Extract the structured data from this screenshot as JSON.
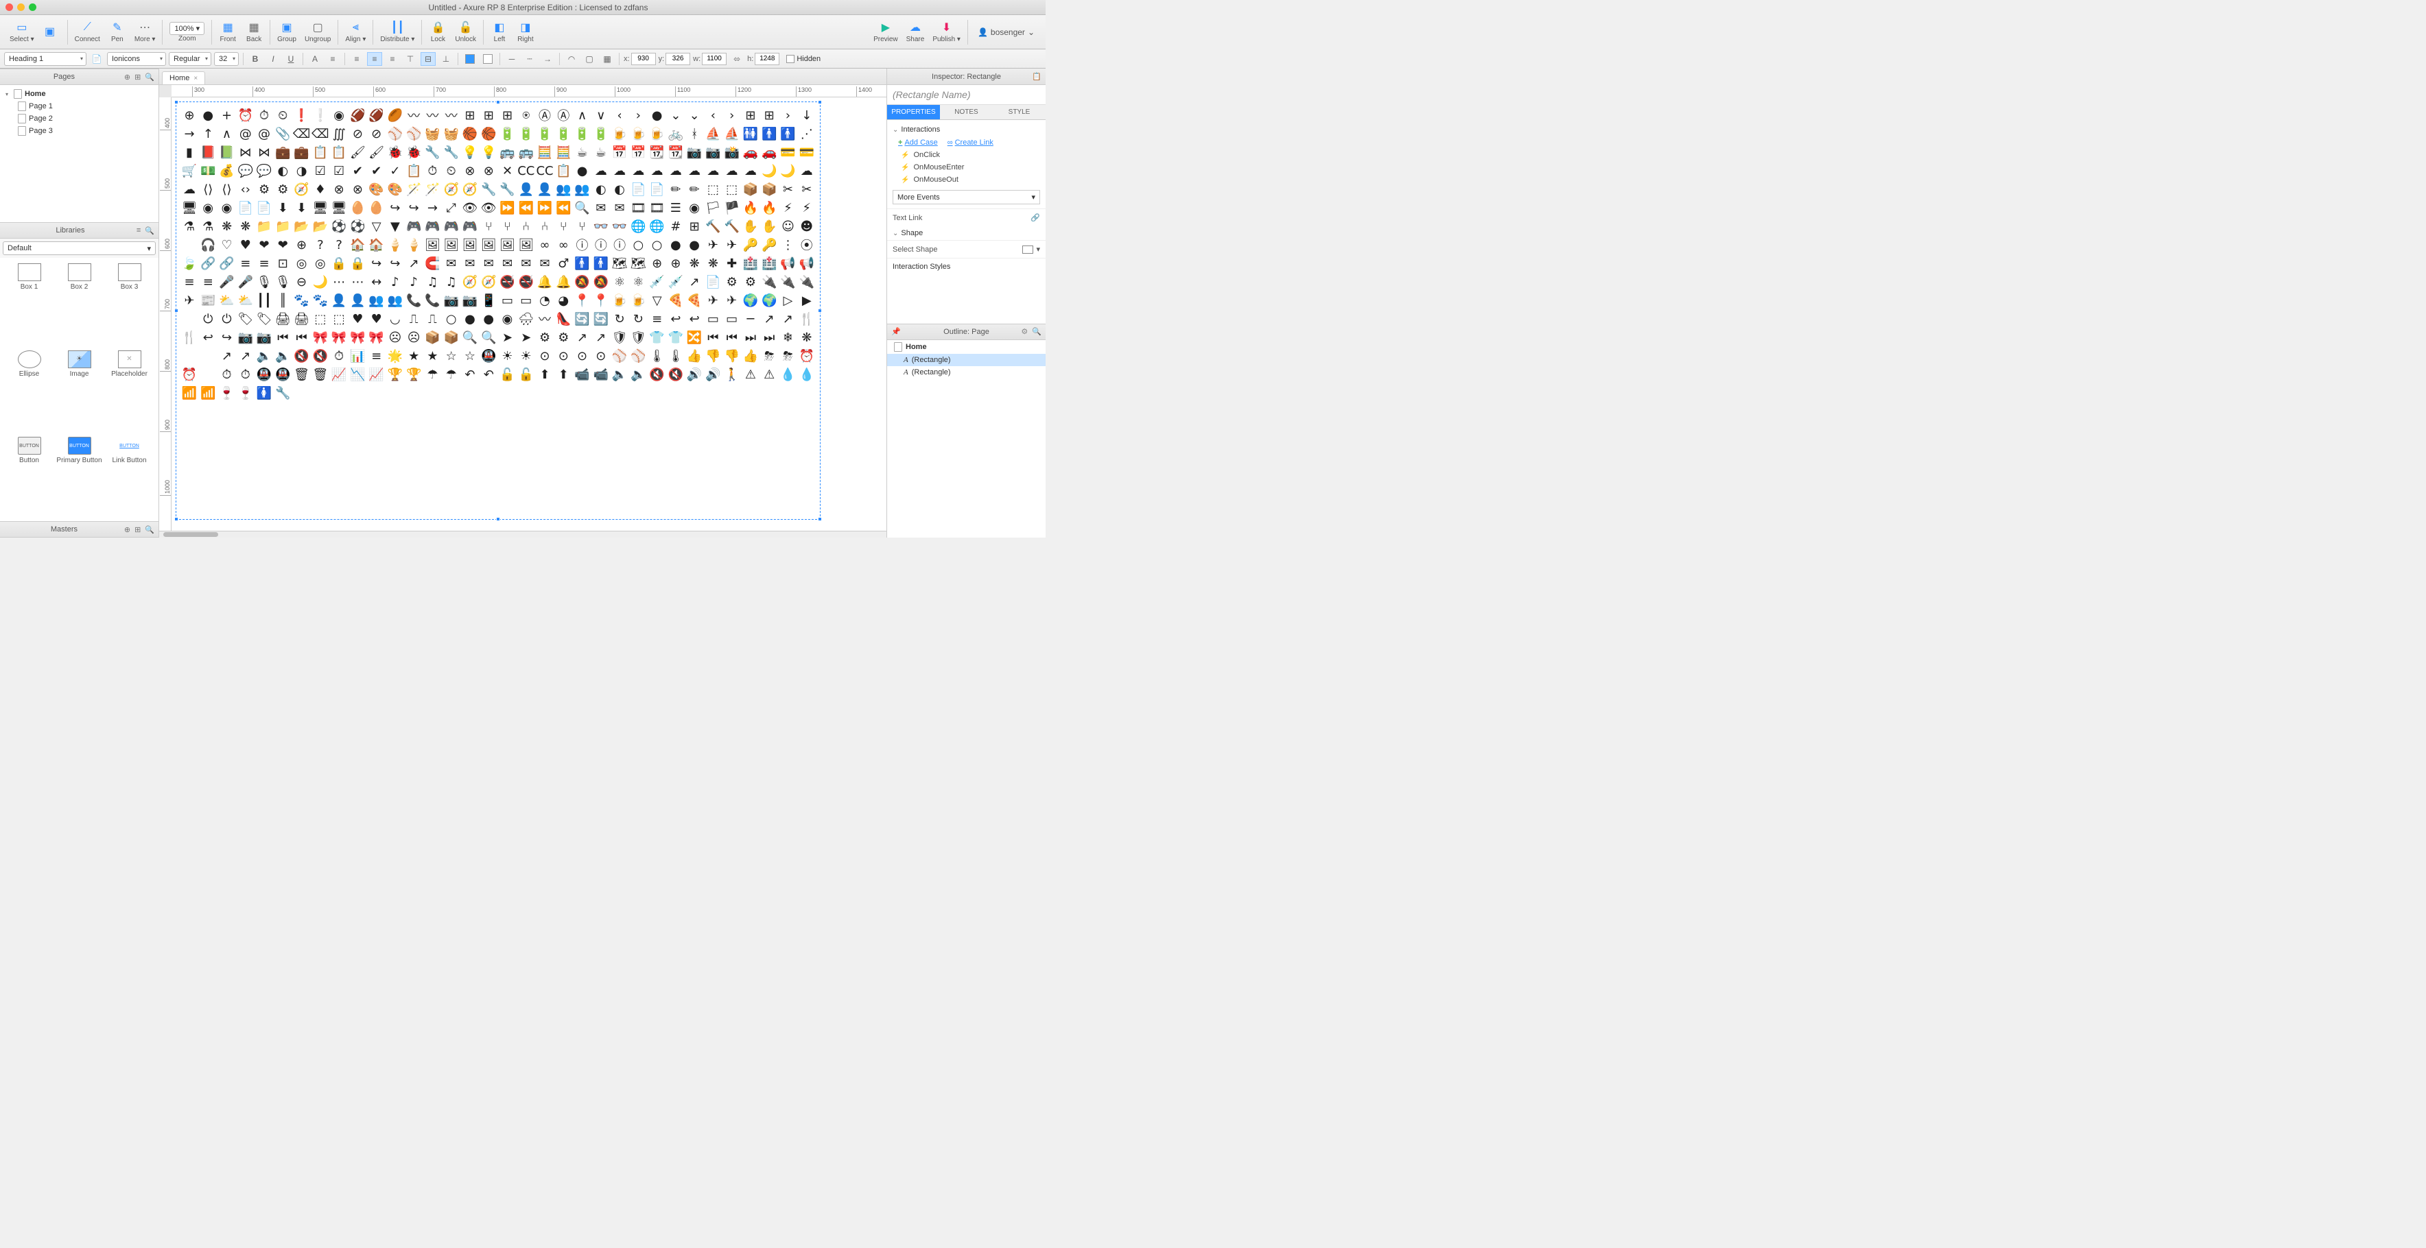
{
  "window": {
    "title": "Untitled - Axure RP 8 Enterprise Edition : Licensed to zdfans"
  },
  "user": {
    "name": "bosenger"
  },
  "toolbar": {
    "select": "Select ▾",
    "connect": "Connect",
    "pen": "Pen",
    "more": "More ▾",
    "zoom_level": "100% ▾",
    "zoom": "Zoom",
    "front": "Front",
    "back": "Back",
    "group": "Group",
    "ungroup": "Ungroup",
    "align": "Align ▾",
    "distribute": "Distribute ▾",
    "lock": "Lock",
    "unlock": "Unlock",
    "left": "Left",
    "right": "Right",
    "preview": "Preview",
    "share": "Share",
    "publish": "Publish ▾"
  },
  "format": {
    "heading_style": "Heading 1",
    "font": "Ionicons",
    "weight": "Regular",
    "size": "32",
    "x": "930",
    "y": "326",
    "w": "1100",
    "h": "1248",
    "hidden": "Hidden"
  },
  "panels": {
    "pages": "Pages",
    "libraries": "Libraries",
    "masters": "Masters",
    "inspector": "Inspector: Rectangle",
    "outline": "Outline: Page"
  },
  "pages_tree": {
    "root": "Home",
    "children": [
      "Page 1",
      "Page 2",
      "Page 3"
    ]
  },
  "libraries": {
    "selected": "Default",
    "items": [
      "Box 1",
      "Box 2",
      "Box 3",
      "Ellipse",
      "Image",
      "Placeholder",
      "Button",
      "Primary Button",
      "Link Button"
    ]
  },
  "tab": {
    "name": "Home"
  },
  "ruler_h": [
    "300",
    "400",
    "500",
    "600",
    "700",
    "800",
    "900",
    "1000",
    "1100",
    "1200",
    "1300",
    "1400"
  ],
  "ruler_v": [
    "400",
    "500",
    "600",
    "700",
    "800",
    "900",
    "1000"
  ],
  "inspector": {
    "name_placeholder": "(Rectangle Name)",
    "tabs": [
      "PROPERTIES",
      "NOTES",
      "STYLE"
    ],
    "interactions": "Interactions",
    "add_case": "Add Case",
    "create_link": "Create Link",
    "events": [
      "OnClick",
      "OnMouseEnter",
      "OnMouseOut"
    ],
    "more_events": "More Events",
    "text_link": "Text Link",
    "shape": "Shape",
    "select_shape": "Select Shape",
    "interaction_styles": "Interaction Styles"
  },
  "outline": {
    "root": "Home",
    "items": [
      "(Rectangle)",
      "(Rectangle)"
    ]
  },
  "colors": {
    "accent": "#2d8cff",
    "fill": "#3399ff"
  },
  "icons_sample": [
    "+",
    "●",
    "+",
    "⏰",
    "⏰",
    "⏰",
    "❗",
    "❗",
    "⭕",
    "⚽",
    "⚽",
    "⚽",
    "∿",
    "∿",
    "∿",
    "⊞",
    "⊞",
    "⊞",
    "⊕",
    "Ⓐ",
    "Ⓐ",
    "∧",
    "∨",
    "‹",
    "›",
    "●",
    "⌄",
    "⌄",
    "‹",
    "›",
    "⊞",
    "⊞",
    "›",
    "↓"
  ]
}
